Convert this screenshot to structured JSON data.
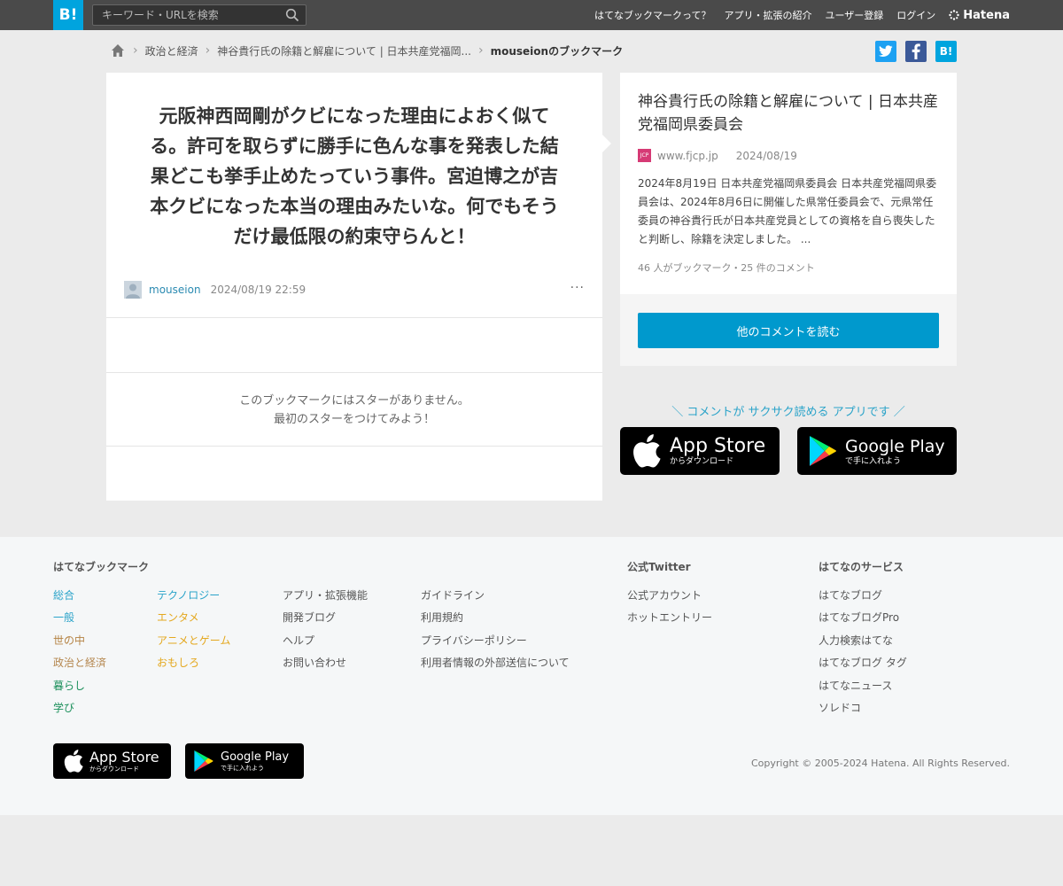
{
  "header": {
    "logo": "B!",
    "search_placeholder": "キーワード・URLを検索",
    "nav": [
      "はてなブックマークって？",
      "アプリ・拡張の紹介",
      "ユーザー登録",
      "ログイン"
    ],
    "brand": "Hatena"
  },
  "breadcrumb": {
    "items": [
      "政治と経済",
      "神谷貴行氏の除籍と解雇について | 日本共産党福岡...",
      "mouseionのブックマーク"
    ]
  },
  "share": {
    "hb": "B!"
  },
  "bookmark": {
    "comment": "元阪神西岡剛がクビになった理由によおく似てる。許可を取らずに勝手に色んな事を発表した結果どこも挙手止めたっていう事件。宮迫博之が吉本クビになった本当の理由みたいな。何でもそうだけ最低限の約束守らんと！",
    "user": "mouseion",
    "date": "2024/08/19 22:59",
    "more": "···",
    "no_star_line1": "このブックマークにはスターがありません。",
    "no_star_line2": "最初のスターをつけてみよう！"
  },
  "entry": {
    "title": "神谷貴行氏の除籍と解雇について | 日本共産党福岡県委員会",
    "site_icon": "JCP",
    "site": "www.fjcp.jp",
    "date": "2024/08/19",
    "description": "2024年8月19日 日本共産党福岡県委員会 日本共産党福岡県委員会は、2024年8月6日に開催した県常任委員会で、元県常任委員の神谷貴行氏が日本共産党員としての資格を自ら喪失したと判断し、除籍を決定しました。 ...",
    "counts": "46 人がブックマーク・25 件のコメント",
    "read_button": "他のコメントを読む"
  },
  "promo": {
    "text": "＼ コメントが サクサク読める アプリです ／",
    "app_store_title": "App Store",
    "app_store_sub": "からダウンロード",
    "google_play_title": "Google Play",
    "google_play_sub": "で手に入れよう"
  },
  "footer": {
    "bookmark_heading": "はてなブックマーク",
    "categories_col1": [
      "総合",
      "一般",
      "世の中",
      "政治と経済",
      "暮らし",
      "学び"
    ],
    "categories_col2": [
      "テクノロジー",
      "エンタメ",
      "アニメとゲーム",
      "おもしろ"
    ],
    "links_col3": [
      "アプリ・拡張機能",
      "開発ブログ",
      "ヘルプ",
      "お問い合わせ"
    ],
    "links_col4": [
      "ガイドライン",
      "利用規約",
      "プライバシーポリシー",
      "利用者情報の外部送信について"
    ],
    "twitter_heading": "公式Twitter",
    "twitter_links": [
      "公式アカウント",
      "ホットエントリー"
    ],
    "services_heading": "はてなのサービス",
    "services_links": [
      "はてなブログ",
      "はてなブログPro",
      "人力検索はてな",
      "はてなブログ タグ",
      "はてなニュース",
      "ソレドコ"
    ],
    "copyright": "Copyright © 2005-2024 Hatena. All Rights Reserved."
  },
  "colors": {
    "sogo": "#2aa3c9",
    "ippan": "#2aa3c9",
    "yononaka": "#b58344",
    "seiji": "#b5874f",
    "kurashi": "#1a8f5a",
    "manabi": "#1a8f5a",
    "tech": "#2aa3c9",
    "entame": "#e4a81f",
    "anime": "#e4a81f",
    "omoshiro": "#e4a81f"
  }
}
